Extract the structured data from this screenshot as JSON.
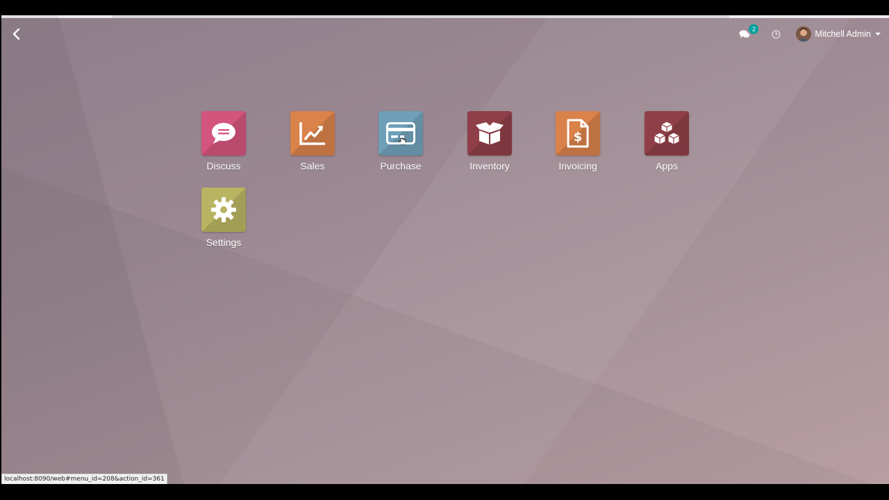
{
  "navbar": {
    "messages_badge": "2",
    "user_name": "Mitchell Admin"
  },
  "apps": [
    {
      "label": "Discuss",
      "color": "#d3557d",
      "icon": "chat-icon"
    },
    {
      "label": "Sales",
      "color": "#d9824a",
      "icon": "chart-up-icon"
    },
    {
      "label": "Purchase",
      "color": "#6fa0b8",
      "icon": "credit-card-icon"
    },
    {
      "label": "Inventory",
      "color": "#8e3f47",
      "icon": "box-icon"
    },
    {
      "label": "Invoicing",
      "color": "#d9824a",
      "icon": "invoice-dollar-icon"
    },
    {
      "label": "Apps",
      "color": "#8e3f47",
      "icon": "cubes-icon"
    },
    {
      "label": "Settings",
      "color": "#b9b462",
      "icon": "gear-icon"
    }
  ],
  "status_bar": {
    "url": "localhost:8090/web#menu_id=208&action_id=361"
  }
}
